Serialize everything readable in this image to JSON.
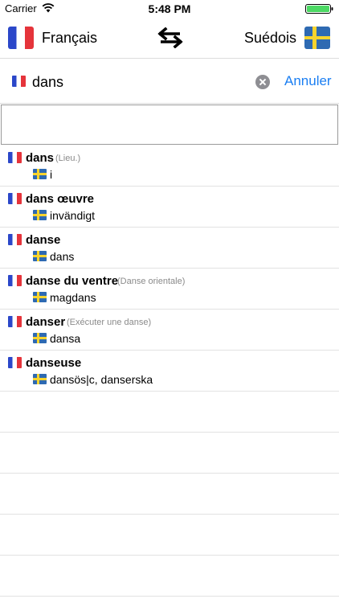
{
  "status_bar": {
    "carrier": "Carrier",
    "time": "5:48 PM"
  },
  "nav": {
    "source_language": "Français",
    "target_language": "Suédois",
    "source_flag_icon": "flag-france-icon",
    "target_flag_icon": "flag-sweden-icon",
    "swap_icon": "swap-arrows-icon"
  },
  "search": {
    "value": "dans",
    "cancel_label": "Annuler"
  },
  "results": [
    {
      "term": "dans",
      "context": "(Lieu.)",
      "translation": "i"
    },
    {
      "term": "dans œuvre",
      "context": "",
      "translation": "invändigt"
    },
    {
      "term": "danse",
      "context": "",
      "translation": "dans"
    },
    {
      "term": "danse du ventre",
      "context": "(Danse orientale)",
      "translation": "magdans"
    },
    {
      "term": "danser",
      "context": "(Exécuter une danse)",
      "translation": "dansa"
    },
    {
      "term": "danseuse",
      "context": "",
      "translation": "dansös|c, danserska"
    }
  ],
  "colors": {
    "accent": "#1a7ef2",
    "context_text": "#8a8a8a",
    "separator": "#e2e2e2"
  }
}
